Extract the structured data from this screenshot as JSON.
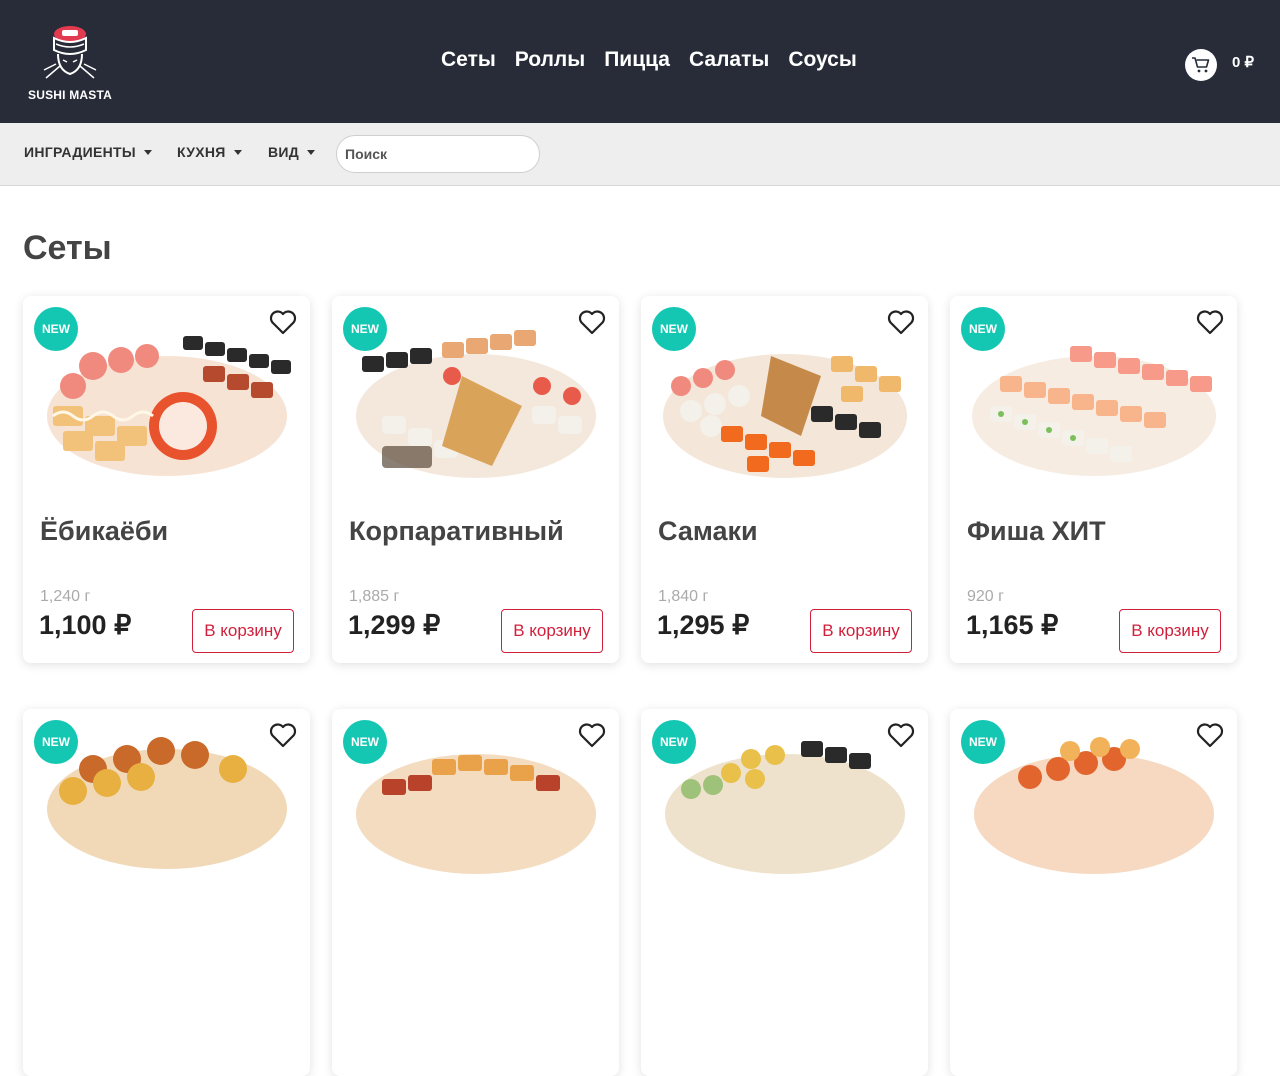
{
  "brand": {
    "name": "SUSHI MASTA"
  },
  "nav": {
    "items": [
      "Сеты",
      "Роллы",
      "Пицца",
      "Салаты",
      "Соусы"
    ]
  },
  "cart": {
    "total": "0 ₽"
  },
  "filters": {
    "ingredients": "ИНГРАДИЕНТЫ",
    "cuisine": "КУХНЯ",
    "view": "ВИД",
    "search_placeholder": "Поиск"
  },
  "section": {
    "title": "Сеты"
  },
  "products": [
    {
      "badge": "NEW",
      "name": "Ёбикаёби",
      "weight": "1,240 г",
      "price": "1,100 ₽",
      "button": "В корзину"
    },
    {
      "badge": "NEW",
      "name": "Корпаративный",
      "weight": "1,885 г",
      "price": "1,299 ₽",
      "button": "В корзину"
    },
    {
      "badge": "NEW",
      "name": "Самаки",
      "weight": "1,840 г",
      "price": "1,295 ₽",
      "button": "В корзину"
    },
    {
      "badge": "NEW",
      "name": "Фиша ХИТ",
      "weight": "920 г",
      "price": "1,165 ₽",
      "button": "В корзину"
    },
    {
      "badge": "NEW"
    },
    {
      "badge": "NEW"
    },
    {
      "badge": "NEW"
    },
    {
      "badge": "NEW"
    }
  ],
  "colors": {
    "header": "#272c38",
    "accent_badge": "#14c7b2",
    "button": "#d0213c",
    "filterbar": "#eeeeee"
  }
}
